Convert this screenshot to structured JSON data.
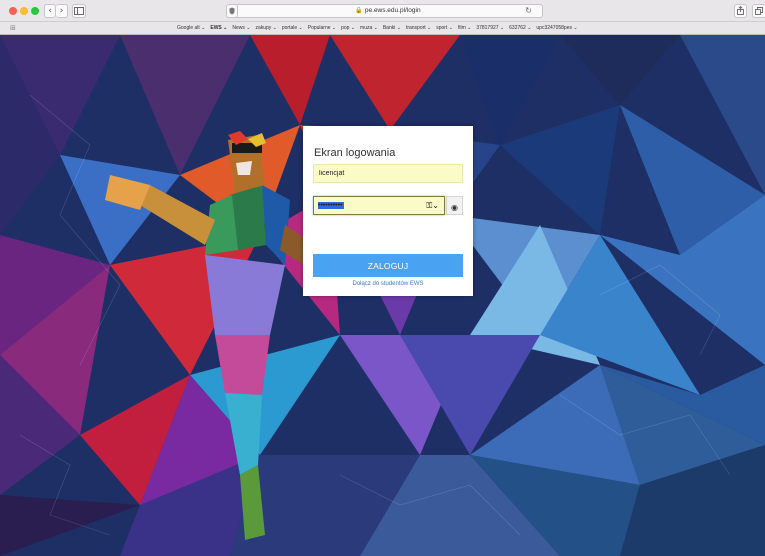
{
  "browser": {
    "address": "pe.ews.edu.pl/login",
    "reload_glyph": "↻",
    "icons": {
      "back": "chevron-left-icon",
      "forward": "chevron-right-icon",
      "sidebar": "sidebar-icon",
      "privacy": "privacy-shield-icon",
      "lock": "lock-icon",
      "reload": "reload-icon",
      "share": "share-icon",
      "tabs": "tabs-icon",
      "grid": "grid-icon"
    },
    "traffic_lights": {
      "close": "#fc5f57",
      "minimize": "#fdbc2e",
      "maximize": "#27c840"
    }
  },
  "bookmarks": [
    {
      "label": "Google alt ⌄",
      "bold": false
    },
    {
      "label": "EWS ⌄",
      "bold": true
    },
    {
      "label": "News ⌄",
      "bold": false
    },
    {
      "label": "zakupy ⌄",
      "bold": false
    },
    {
      "label": "portale ⌄",
      "bold": false
    },
    {
      "label": "Popularne ⌄",
      "bold": false
    },
    {
      "label": "pop ⌄",
      "bold": false
    },
    {
      "label": "muza ⌄",
      "bold": false
    },
    {
      "label": "Banki ⌄",
      "bold": false
    },
    {
      "label": "transport ⌄",
      "bold": false
    },
    {
      "label": "sport ⌄",
      "bold": false
    },
    {
      "label": "film ⌄",
      "bold": false
    },
    {
      "label": "37817927 ⌄",
      "bold": false
    },
    {
      "label": "632762 ⌄",
      "bold": false
    },
    {
      "label": "upc3247058pes ⌄",
      "bold": false
    }
  ],
  "login": {
    "title": "Ekran logowania",
    "username_value": "licencjat",
    "password_value": "••••••••••",
    "submit_label": "ZALOGUJ",
    "join_link": "Dołącz do studentów EWS",
    "colors": {
      "button": "#4aa3f2",
      "autofill": "#fbfbc8",
      "link": "#3a7bd5"
    }
  }
}
